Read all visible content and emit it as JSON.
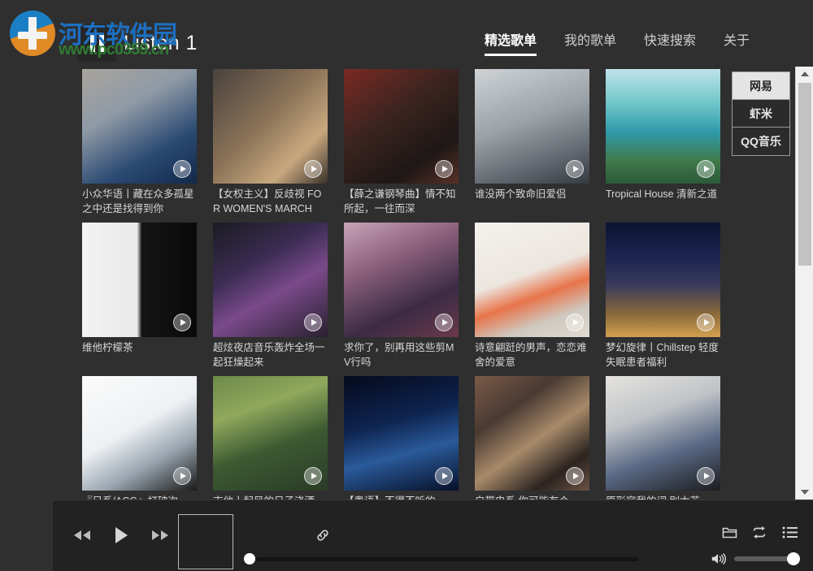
{
  "app": {
    "title": "Listen 1",
    "logo_icon": "pause-bars-logo"
  },
  "watermark": {
    "site_name": "河东软件园",
    "site_url": "www.pc0359.cn"
  },
  "nav": {
    "items": [
      {
        "label": "精选歌单",
        "active": true
      },
      {
        "label": "我的歌单",
        "active": false
      },
      {
        "label": "快速搜索",
        "active": false
      },
      {
        "label": "关于",
        "active": false
      }
    ]
  },
  "sources": {
    "items": [
      {
        "label": "网易",
        "active": true
      },
      {
        "label": "虾米",
        "active": false
      },
      {
        "label": "QQ音乐",
        "active": false
      }
    ]
  },
  "playlists": [
    {
      "title": "小众华语丨藏在众多孤星之中还是找得到你",
      "cover": "woman-headphones-blue-lights",
      "play_icon": "play-icon"
    },
    {
      "title": "【女权主义】反歧视 FOR WOMEN'S MARCH",
      "cover": "woman-smoking-portrait",
      "play_icon": "play-icon"
    },
    {
      "title": "【薛之谦钢琴曲】情不知所起，一往而深",
      "cover": "man-glasses-red-room",
      "play_icon": "play-icon"
    },
    {
      "title": "谁没两个致命旧爱侣",
      "cover": "man-lying-on-bed",
      "play_icon": "play-icon"
    },
    {
      "title": "Tropical House 清新之道",
      "cover": "tropical-beach-turquoise-sea",
      "play_icon": "play-icon"
    },
    {
      "title": "维他柠檬茶",
      "cover": "monokuma-black-white-bear",
      "play_icon": "play-icon"
    },
    {
      "title": "超炫夜店音乐轰炸全场一起狂燥起来",
      "cover": "dj-turntable-neon",
      "play_icon": "play-icon"
    },
    {
      "title": "求你了，别再用这些剪MV行吗",
      "cover": "anime-girl-purple-hat-street",
      "play_icon": "play-icon"
    },
    {
      "title": "诗意翩跹的男声，恋恋难舍的爱意",
      "cover": "illustrated-boy-orange-flowers",
      "play_icon": "play-icon"
    },
    {
      "title": "梦幻旋律丨Chillstep 轻度失眠患者福利",
      "cover": "starry-night-lone-figure",
      "play_icon": "play-icon"
    },
    {
      "title": "『日系/ACG』打破次",
      "cover": "anime-white-hair-girl",
      "play_icon": "play-icon"
    },
    {
      "title": "吉他丨起风的日子浇洒",
      "cover": "couple-guitar-outdoors",
      "play_icon": "play-icon"
    },
    {
      "title": "【粤语】不得不听的一",
      "cover": "stage-duet-blue-light",
      "play_icon": "play-icon"
    },
    {
      "title": "自带电系 你可能有个",
      "cover": "crowd-faces-collage",
      "play_icon": "play-icon"
    },
    {
      "title": "原形容我的词 别太苦",
      "cover": "man-denim-jeans-seated",
      "play_icon": "play-icon"
    }
  ],
  "player": {
    "prev_icon": "previous-track-icon",
    "play_icon": "play-icon",
    "next_icon": "next-track-icon",
    "album_art_placeholder": "",
    "link_icon": "link-icon",
    "progress_percent": 0,
    "folder_icon": "folder-icon",
    "repeat_icon": "repeat-icon",
    "playlist_icon": "playlist-icon",
    "volume_icon": "volume-icon",
    "volume_percent": 100
  },
  "scrollbar": {
    "up_icon": "scroll-up-arrow-icon",
    "down_icon": "scroll-down-arrow-icon",
    "thumb_position_percent": 4
  }
}
